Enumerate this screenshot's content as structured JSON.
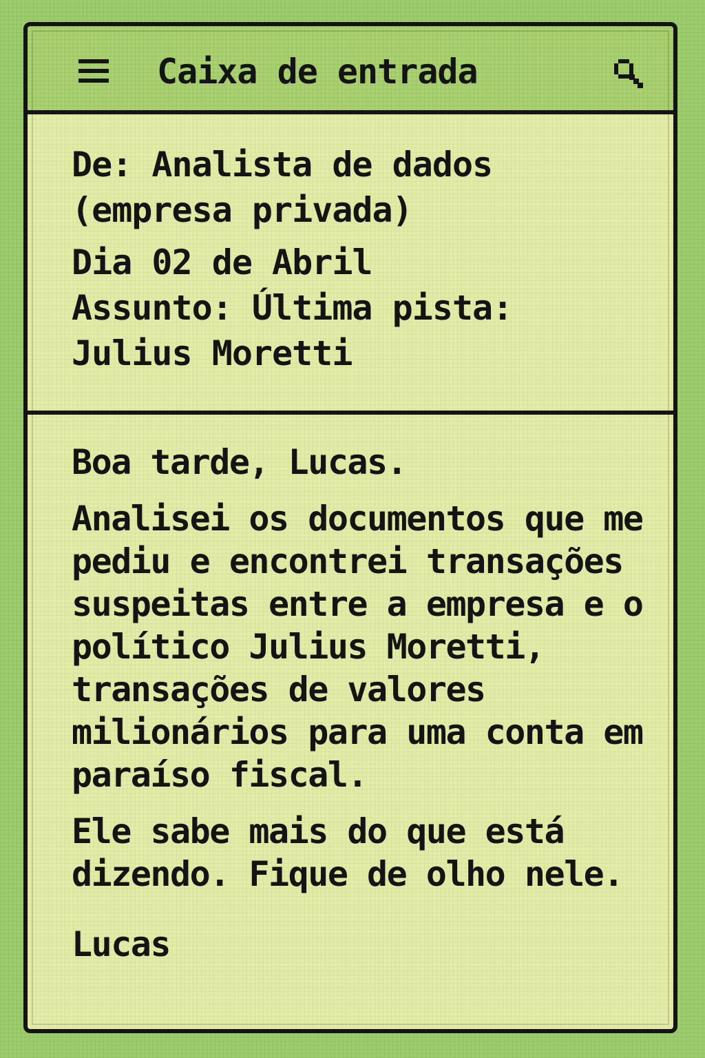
{
  "header": {
    "menu_icon": "hamburger-menu-icon",
    "title": "Caixa de entrada",
    "search_icon": "magnifier-search-icon"
  },
  "email": {
    "from": "De: Analista de dados (empresa privada)",
    "date": "Dia 02 de Abril",
    "subject": "Assunto: Última pista: Julius Moretti",
    "greeting": "Boa tarde, Lucas.",
    "body_paragraph_1": "Analisei os documentos que me pediu e encontrei transações suspeitas entre a empresa e o político Julius Moretti, transações de valores milionários para uma conta em paraíso fiscal.",
    "body_paragraph_2": "Ele sabe mais do que está dizendo. Fique de olho nele.",
    "signature": "Lucas"
  },
  "colors": {
    "background": "#9ccc6c",
    "screen": "#e2eca6",
    "header": "#a9d16f",
    "ink": "#141414"
  }
}
